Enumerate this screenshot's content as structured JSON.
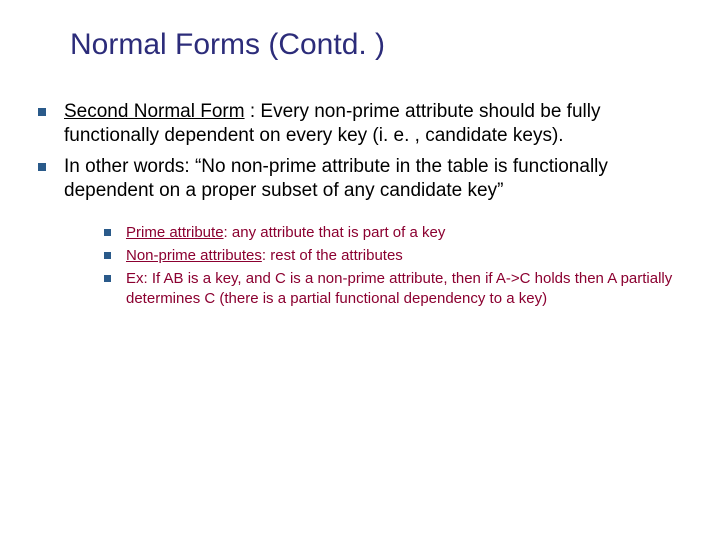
{
  "title": "Normal Forms (Contd. )",
  "bullets": [
    {
      "lead_underlined": "Second Normal Form",
      "rest": " : Every non-prime attribute should be fully functionally dependent on every key (i. e. , candidate keys)."
    },
    {
      "lead_underlined": "",
      "rest": "In other words: “No non-prime attribute in the table is functionally dependent on a proper subset of any candidate key”"
    }
  ],
  "sub_bullets": [
    {
      "lead_underlined": "Prime attribute",
      "rest": ": any attribute that is part of a  key"
    },
    {
      "lead_underlined": "Non-prime attributes",
      "rest": ": rest of the attributes"
    },
    {
      "lead_underlined": "",
      "rest": "Ex: If AB is a key, and C is a non-prime attribute, then if A->C holds then A partially determines C (there is a partial functional dependency to a key)"
    }
  ]
}
